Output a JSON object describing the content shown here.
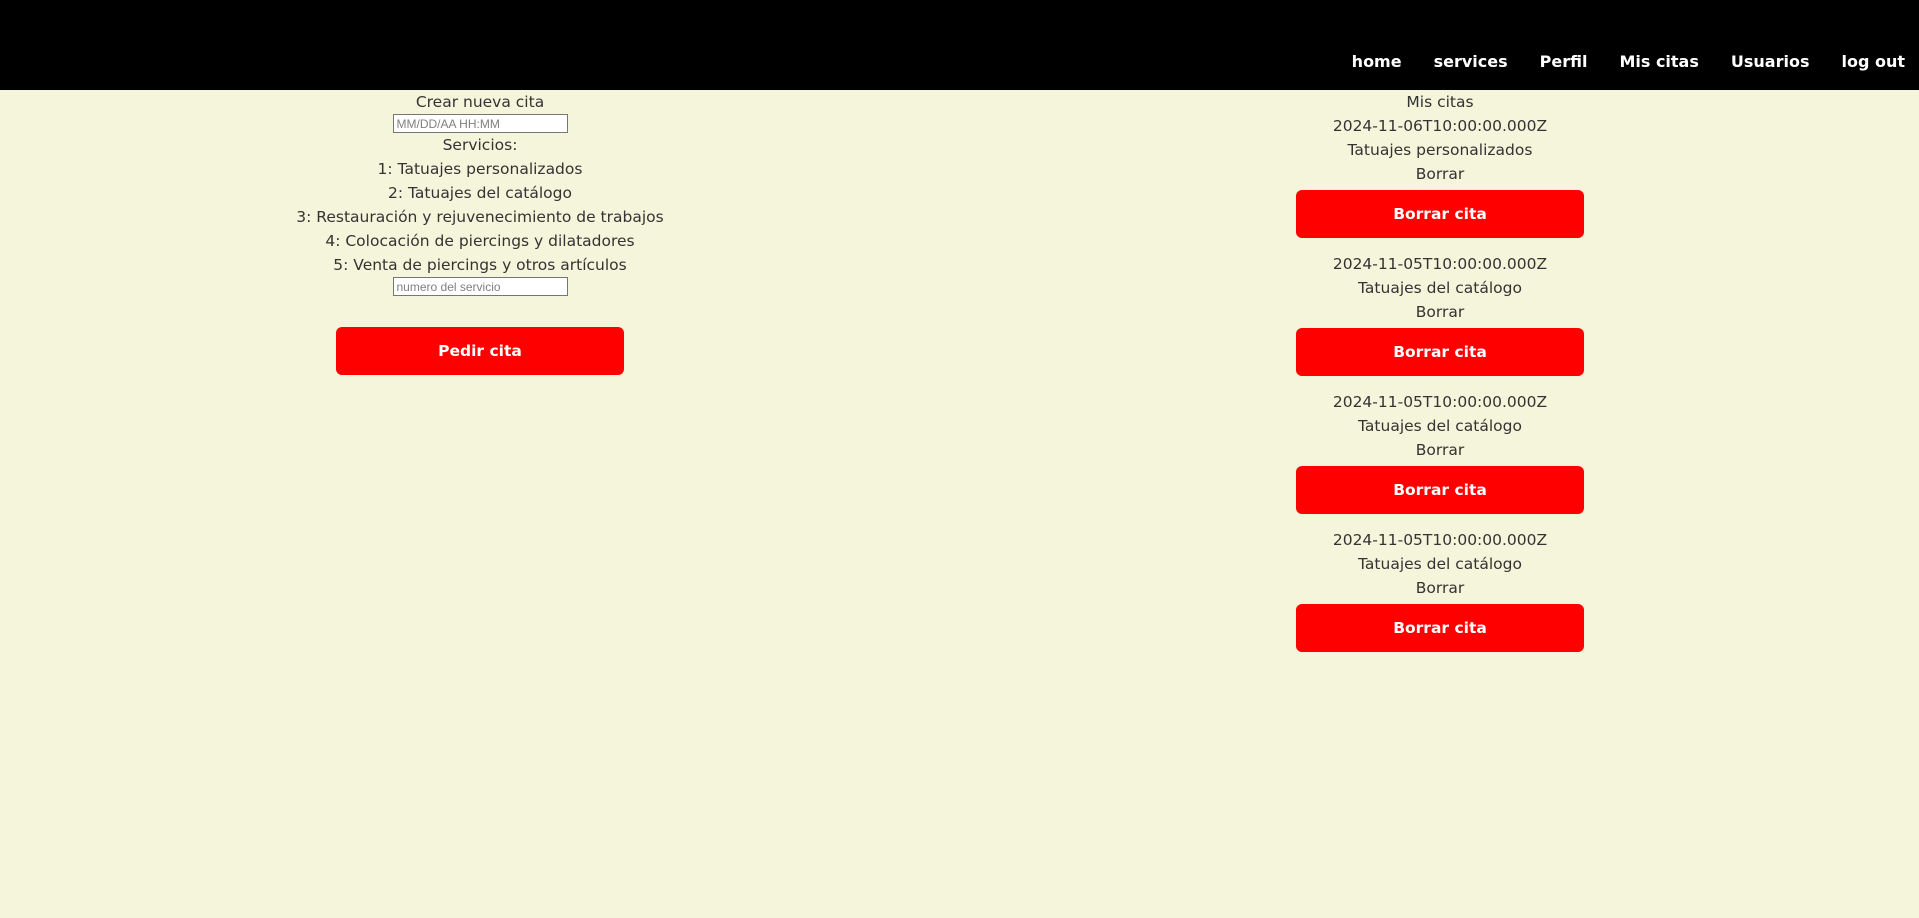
{
  "nav": {
    "items": [
      "home",
      "services",
      "Perfil",
      "Mis citas",
      "Usuarios",
      "log out"
    ]
  },
  "create": {
    "title": "Crear nueva cita",
    "date_placeholder": "MM/DD/AA HH:MM",
    "services_label": "Servicios:",
    "services": [
      "1: Tatuajes personalizados",
      "2: Tatuajes del catálogo",
      "3: Restauración y rejuvenecimiento de trabajos",
      "4: Colocación de piercings y dilatadores",
      "5: Venta de piercings y otros artículos"
    ],
    "service_placeholder": "numero del servicio",
    "submit_label": "Pedir cita"
  },
  "appointments": {
    "title": "Mis citas",
    "items": [
      {
        "date": "2024-11-06T10:00:00.000Z",
        "service": "Tatuajes personalizados",
        "delete_text": "Borrar",
        "button_label": "Borrar cita"
      },
      {
        "date": "2024-11-05T10:00:00.000Z",
        "service": "Tatuajes del catálogo",
        "delete_text": "Borrar",
        "button_label": "Borrar cita"
      },
      {
        "date": "2024-11-05T10:00:00.000Z",
        "service": "Tatuajes del catálogo",
        "delete_text": "Borrar",
        "button_label": "Borrar cita"
      },
      {
        "date": "2024-11-05T10:00:00.000Z",
        "service": "Tatuajes del catálogo",
        "delete_text": "Borrar",
        "button_label": "Borrar cita"
      }
    ]
  },
  "colors": {
    "background": "#f5f5dc",
    "navbar": "#000000",
    "button": "#ff0000"
  }
}
